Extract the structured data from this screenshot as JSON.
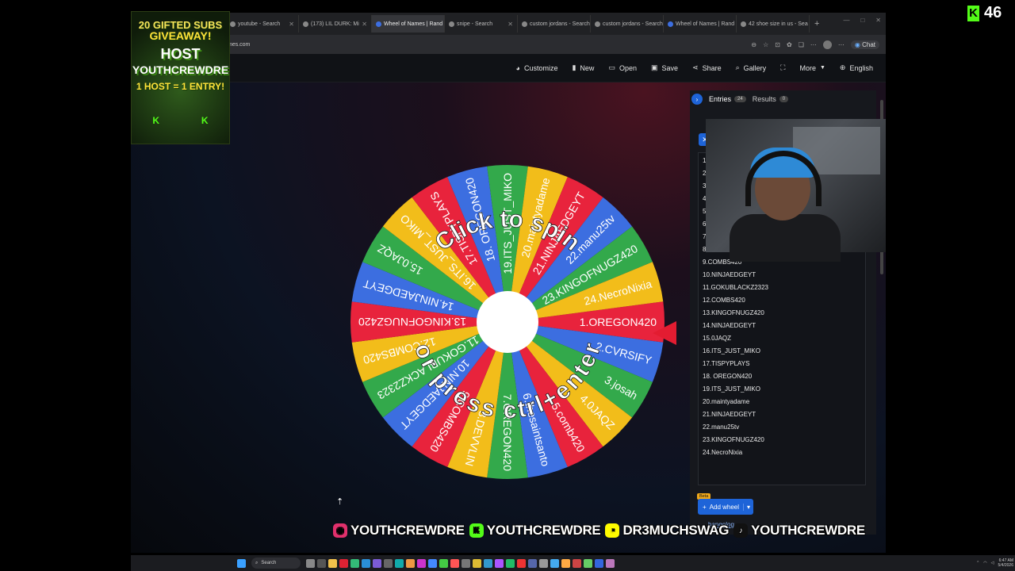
{
  "browser": {
    "tabs": [
      {
        "label": "youtube - Search",
        "active": false
      },
      {
        "label": "(173) LIL DURK: Mi",
        "active": false
      },
      {
        "label": "Wheel of Names | Rand",
        "active": true
      },
      {
        "label": "snipe - Search",
        "active": false
      },
      {
        "label": "custom jordans - Search",
        "active": false
      },
      {
        "label": "custom jordans - Search",
        "active": false
      },
      {
        "label": "Wheel of Names | Rand",
        "active": false
      },
      {
        "label": "42 shoe size in us - Sea",
        "active": false
      }
    ],
    "url": "mes.com",
    "chat_label": "Chat"
  },
  "toolbar": {
    "items": [
      {
        "icon": "palette-icon",
        "label": "Customize"
      },
      {
        "icon": "new-file-icon",
        "label": "New"
      },
      {
        "icon": "folder-icon",
        "label": "Open"
      },
      {
        "icon": "save-icon",
        "label": "Save"
      },
      {
        "icon": "share-icon",
        "label": "Share"
      },
      {
        "icon": "search-icon",
        "label": "Gallery"
      },
      {
        "icon": "fullscreen-icon",
        "label": ""
      },
      {
        "icon": "more-icon",
        "label": "More"
      },
      {
        "icon": "globe-icon",
        "label": "English"
      }
    ]
  },
  "wheel": {
    "center_text_top": "Click to spin",
    "center_text_bottom": "or press ctrl+enter",
    "colors": [
      "#e8233c",
      "#3c6ee0",
      "#33a94b",
      "#f2bd1a"
    ],
    "entries": [
      "1.OREGON420",
      "2.CVRSIFY",
      "3.josah",
      "4.0JAQZ",
      "5.comb420",
      "6.thesaintsanto",
      "7.OREGON420",
      "8.DEVVLIN",
      "9.COMBS420",
      "10.NINJAEDGEYT",
      "11.GOKUBLACKZ2323",
      "12.COMBS420",
      "13.KINGOFNUGZ420",
      "14.NINJAEDGEYT",
      "15.0JAQZ",
      "16.ITS_JUST_MIKO",
      "17.TISPYPLAYS",
      "18. OREGON420",
      "19.ITS_JUST_MIKO",
      "20.maintyadame",
      "21.NINJAEDGEYT",
      "22.manu25tv",
      "23.KINGOFNUGZ420",
      "24.NecroNixia"
    ]
  },
  "panel": {
    "tab_entries": "Entries",
    "entries_count": "24",
    "tab_results": "Results",
    "results_count": "0",
    "partial_numbers": [
      "1.",
      "2.",
      "3.",
      "4.",
      "5.",
      "6.",
      "7.",
      "8."
    ],
    "visible_entries": [
      "9.COMBS420",
      "10.NINJAEDGEYT",
      "11.GOKUBLACKZ2323",
      "12.COMBS420",
      "13.KINGOFNUGZ420",
      "14.NINJAEDGEYT",
      "15.0JAQZ",
      "16.ITS_JUST_MIKO",
      "17.TISPYPLAYS",
      "18. OREGON420",
      "19.ITS_JUST_MIKO",
      "20.maintyadame",
      "21.NINJAEDGEYT",
      "22.manu25tv",
      "23.KINGOFNUGZ420",
      "24.NecroNixia"
    ],
    "beta_label": "Beta",
    "add_wheel_label": "Add wheel",
    "changelog_label": "hangelog"
  },
  "overlay": {
    "promo": {
      "line1": "20 GIFTED SUBS",
      "line2": "GIVEAWAY!",
      "line3": "HOST",
      "line4": "YOUTHCREWDRE",
      "line5": "1 HOST = 1 ENTRY!",
      "kick_left": "K",
      "kick_right": "K"
    },
    "viewers_letter": "K",
    "viewers": "46",
    "socials": [
      {
        "icon": "instagram-icon",
        "glyph": "◎",
        "color": "#e1306c",
        "handle": "YOUTHCREWDRE"
      },
      {
        "icon": "kick-icon",
        "glyph": "K",
        "color": "#53fc18",
        "handle": "YOUTHCREWDRE"
      },
      {
        "icon": "snapchat-icon",
        "glyph": "◔",
        "color": "#fffc00",
        "handle": "DR3MUCHSWAG"
      },
      {
        "icon": "tiktok-icon",
        "glyph": "♪",
        "color": "#111111",
        "handle": "YOUTHCREWDRE"
      }
    ]
  },
  "taskbar": {
    "search_label": "Search",
    "time": "6:47 AM",
    "date": "5/4/2026"
  }
}
